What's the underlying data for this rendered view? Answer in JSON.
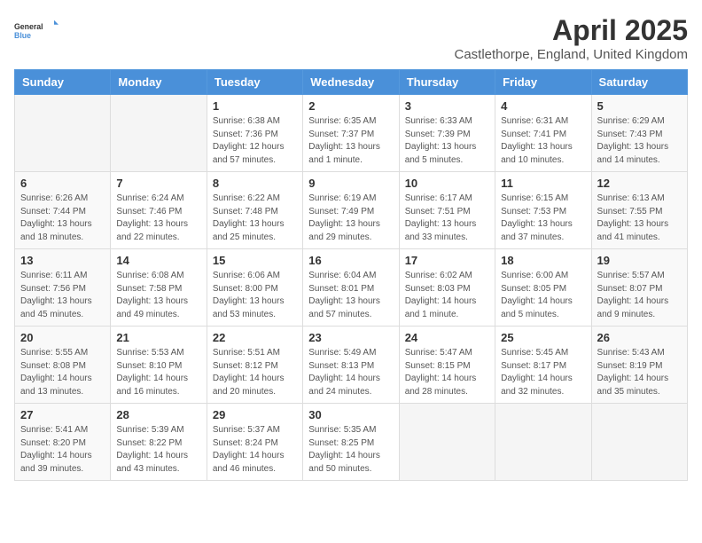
{
  "logo": {
    "general": "General",
    "blue": "Blue"
  },
  "title": "April 2025",
  "subtitle": "Castlethorpe, England, United Kingdom",
  "weekdays": [
    "Sunday",
    "Monday",
    "Tuesday",
    "Wednesday",
    "Thursday",
    "Friday",
    "Saturday"
  ],
  "weeks": [
    [
      {
        "day": "",
        "info": ""
      },
      {
        "day": "",
        "info": ""
      },
      {
        "day": "1",
        "info": "Sunrise: 6:38 AM\nSunset: 7:36 PM\nDaylight: 12 hours and 57 minutes."
      },
      {
        "day": "2",
        "info": "Sunrise: 6:35 AM\nSunset: 7:37 PM\nDaylight: 13 hours and 1 minute."
      },
      {
        "day": "3",
        "info": "Sunrise: 6:33 AM\nSunset: 7:39 PM\nDaylight: 13 hours and 5 minutes."
      },
      {
        "day": "4",
        "info": "Sunrise: 6:31 AM\nSunset: 7:41 PM\nDaylight: 13 hours and 10 minutes."
      },
      {
        "day": "5",
        "info": "Sunrise: 6:29 AM\nSunset: 7:43 PM\nDaylight: 13 hours and 14 minutes."
      }
    ],
    [
      {
        "day": "6",
        "info": "Sunrise: 6:26 AM\nSunset: 7:44 PM\nDaylight: 13 hours and 18 minutes."
      },
      {
        "day": "7",
        "info": "Sunrise: 6:24 AM\nSunset: 7:46 PM\nDaylight: 13 hours and 22 minutes."
      },
      {
        "day": "8",
        "info": "Sunrise: 6:22 AM\nSunset: 7:48 PM\nDaylight: 13 hours and 25 minutes."
      },
      {
        "day": "9",
        "info": "Sunrise: 6:19 AM\nSunset: 7:49 PM\nDaylight: 13 hours and 29 minutes."
      },
      {
        "day": "10",
        "info": "Sunrise: 6:17 AM\nSunset: 7:51 PM\nDaylight: 13 hours and 33 minutes."
      },
      {
        "day": "11",
        "info": "Sunrise: 6:15 AM\nSunset: 7:53 PM\nDaylight: 13 hours and 37 minutes."
      },
      {
        "day": "12",
        "info": "Sunrise: 6:13 AM\nSunset: 7:55 PM\nDaylight: 13 hours and 41 minutes."
      }
    ],
    [
      {
        "day": "13",
        "info": "Sunrise: 6:11 AM\nSunset: 7:56 PM\nDaylight: 13 hours and 45 minutes."
      },
      {
        "day": "14",
        "info": "Sunrise: 6:08 AM\nSunset: 7:58 PM\nDaylight: 13 hours and 49 minutes."
      },
      {
        "day": "15",
        "info": "Sunrise: 6:06 AM\nSunset: 8:00 PM\nDaylight: 13 hours and 53 minutes."
      },
      {
        "day": "16",
        "info": "Sunrise: 6:04 AM\nSunset: 8:01 PM\nDaylight: 13 hours and 57 minutes."
      },
      {
        "day": "17",
        "info": "Sunrise: 6:02 AM\nSunset: 8:03 PM\nDaylight: 14 hours and 1 minute."
      },
      {
        "day": "18",
        "info": "Sunrise: 6:00 AM\nSunset: 8:05 PM\nDaylight: 14 hours and 5 minutes."
      },
      {
        "day": "19",
        "info": "Sunrise: 5:57 AM\nSunset: 8:07 PM\nDaylight: 14 hours and 9 minutes."
      }
    ],
    [
      {
        "day": "20",
        "info": "Sunrise: 5:55 AM\nSunset: 8:08 PM\nDaylight: 14 hours and 13 minutes."
      },
      {
        "day": "21",
        "info": "Sunrise: 5:53 AM\nSunset: 8:10 PM\nDaylight: 14 hours and 16 minutes."
      },
      {
        "day": "22",
        "info": "Sunrise: 5:51 AM\nSunset: 8:12 PM\nDaylight: 14 hours and 20 minutes."
      },
      {
        "day": "23",
        "info": "Sunrise: 5:49 AM\nSunset: 8:13 PM\nDaylight: 14 hours and 24 minutes."
      },
      {
        "day": "24",
        "info": "Sunrise: 5:47 AM\nSunset: 8:15 PM\nDaylight: 14 hours and 28 minutes."
      },
      {
        "day": "25",
        "info": "Sunrise: 5:45 AM\nSunset: 8:17 PM\nDaylight: 14 hours and 32 minutes."
      },
      {
        "day": "26",
        "info": "Sunrise: 5:43 AM\nSunset: 8:19 PM\nDaylight: 14 hours and 35 minutes."
      }
    ],
    [
      {
        "day": "27",
        "info": "Sunrise: 5:41 AM\nSunset: 8:20 PM\nDaylight: 14 hours and 39 minutes."
      },
      {
        "day": "28",
        "info": "Sunrise: 5:39 AM\nSunset: 8:22 PM\nDaylight: 14 hours and 43 minutes."
      },
      {
        "day": "29",
        "info": "Sunrise: 5:37 AM\nSunset: 8:24 PM\nDaylight: 14 hours and 46 minutes."
      },
      {
        "day": "30",
        "info": "Sunrise: 5:35 AM\nSunset: 8:25 PM\nDaylight: 14 hours and 50 minutes."
      },
      {
        "day": "",
        "info": ""
      },
      {
        "day": "",
        "info": ""
      },
      {
        "day": "",
        "info": ""
      }
    ]
  ]
}
